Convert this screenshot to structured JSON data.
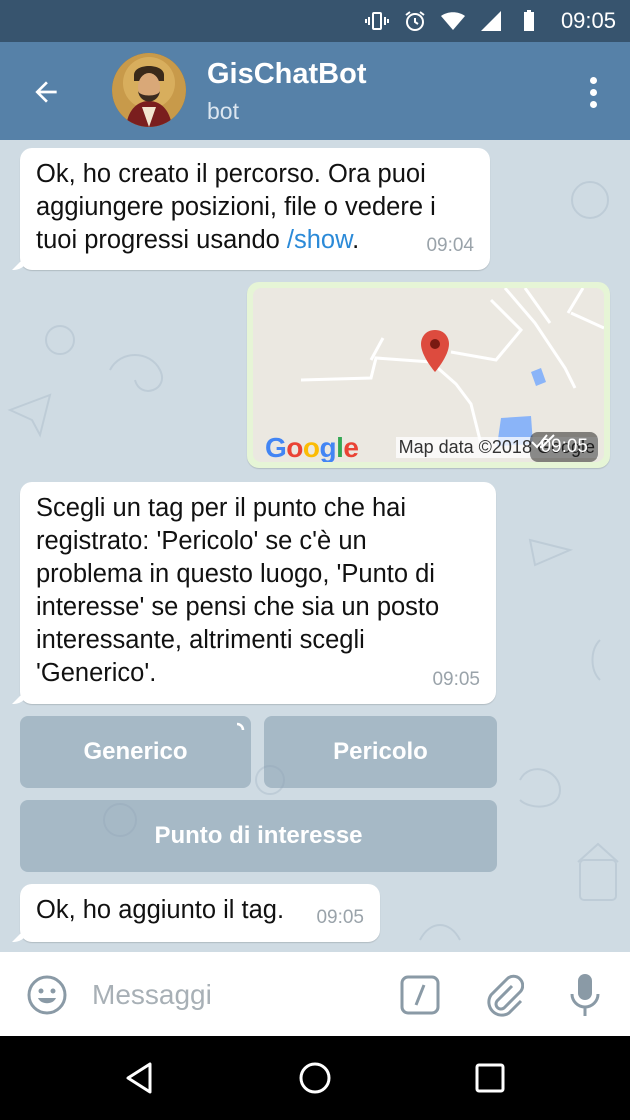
{
  "status_bar": {
    "time": "09:05",
    "icons": [
      "vibrate-icon",
      "alarm-icon",
      "wifi-icon",
      "signal-icon",
      "battery-icon"
    ]
  },
  "header": {
    "title": "GisChatBot",
    "subtitle": "bot",
    "icons": [
      "back-arrow-icon",
      "more-vert-icon"
    ]
  },
  "messages": [
    {
      "text_before_link": "Ok, ho creato il percorso. Ora puoi aggiungere posizioni, file o vedere i tuoi progressi usando ",
      "link": "/show",
      "text_after_link": ".",
      "time": "09:04"
    },
    {
      "type": "map",
      "logo": "Google",
      "attribution": "Map data ©2018 Google",
      "time": "09:05"
    },
    {
      "text": "Scegli un tag per il punto che hai registrato: 'Pericolo' se c'è un problema in questo luogo, 'Punto di interesse' se pensi che sia un posto interessante, altrimenti scegli 'Generico'.",
      "time": "09:05"
    },
    {
      "text": "Ok, ho aggiunto il tag.",
      "time": "09:05"
    }
  ],
  "keyboard": {
    "generico": "Generico",
    "pericolo": "Pericolo",
    "punto": "Punto di interesse"
  },
  "input": {
    "placeholder": "Messaggi",
    "value": ""
  },
  "colors": {
    "status_bar": "#37546e",
    "header": "#5681a8",
    "chat_bg": "#cfdbe3",
    "outgoing_bubble": "#e6f5d6",
    "link": "#2b8ad8"
  }
}
